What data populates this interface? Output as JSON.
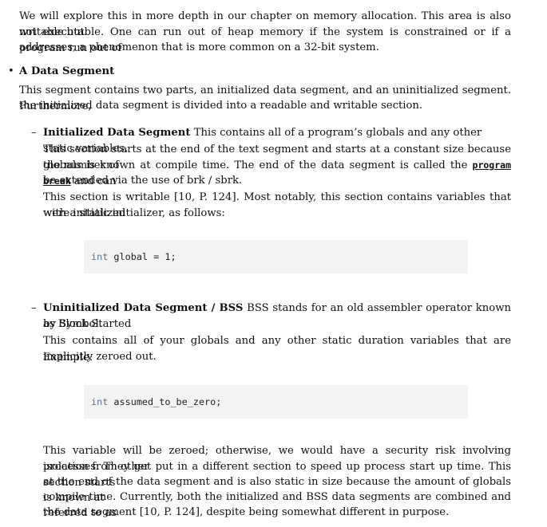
{
  "intro": {
    "line1": "We will explore this in more depth in our chapter on memory allocation. This area is also writable but",
    "line2": "not executable. One can run out of heap memory if the system is constrained or if a program run out of",
    "line3": "addresses, a phenomenon that is more common on a 32-bit system."
  },
  "data_segment": {
    "bullet": "•",
    "heading": "A Data Segment",
    "line1": "This segment contains two parts, an initialized data segment, and an uninitialized segment. Furthermore,",
    "line2": "the initialized data segment is divided into a readable and writable section."
  },
  "initialized": {
    "dash": "–",
    "heading": "Initialized Data Segment",
    "line1_rest": " This contains all of a program’s globals and any other static variables.",
    "line2": "This section starts at the end of the text segment and starts at a constant size because the number of",
    "line3_pre": "globals is known at compile time. The end of the data segment is called the ",
    "link": "program break",
    "line3_post": " and can",
    "line4": "be extended via the use of brk / sbrk.",
    "line5": "This section is writable [10, P. 124]. Most notably, this section contains variables that were initialized",
    "line6": "with a static initializer, as follows:",
    "code_kw": "int",
    "code_rest": " global = 1;"
  },
  "uninitialized": {
    "dash": "–",
    "heading": "Uninitialized Data Segment / BSS",
    "line1_rest": " BSS stands for an old assembler operator known as Block Started",
    "line2": "by Symbol.",
    "line3": "This contains all of your globals and any other static duration variables that are implicitly zeroed out.",
    "line4": "Example:",
    "code_kw": "int",
    "code_rest": " assumed_to_be_zero;",
    "after1": "This variable will be zeroed; otherwise, we would have a security risk involving isolation from other",
    "after2": "processes. They get put in a different section to speed up process start up time. This section starts",
    "after3": "at the end of the data segment and is also static in size because the amount of globals is known at",
    "after4": "compile time. Currently, both the initialized and BSS data segments are combined and referred to as",
    "after5": "the data segment [10, P. 124], despite being somewhat different in purpose."
  }
}
